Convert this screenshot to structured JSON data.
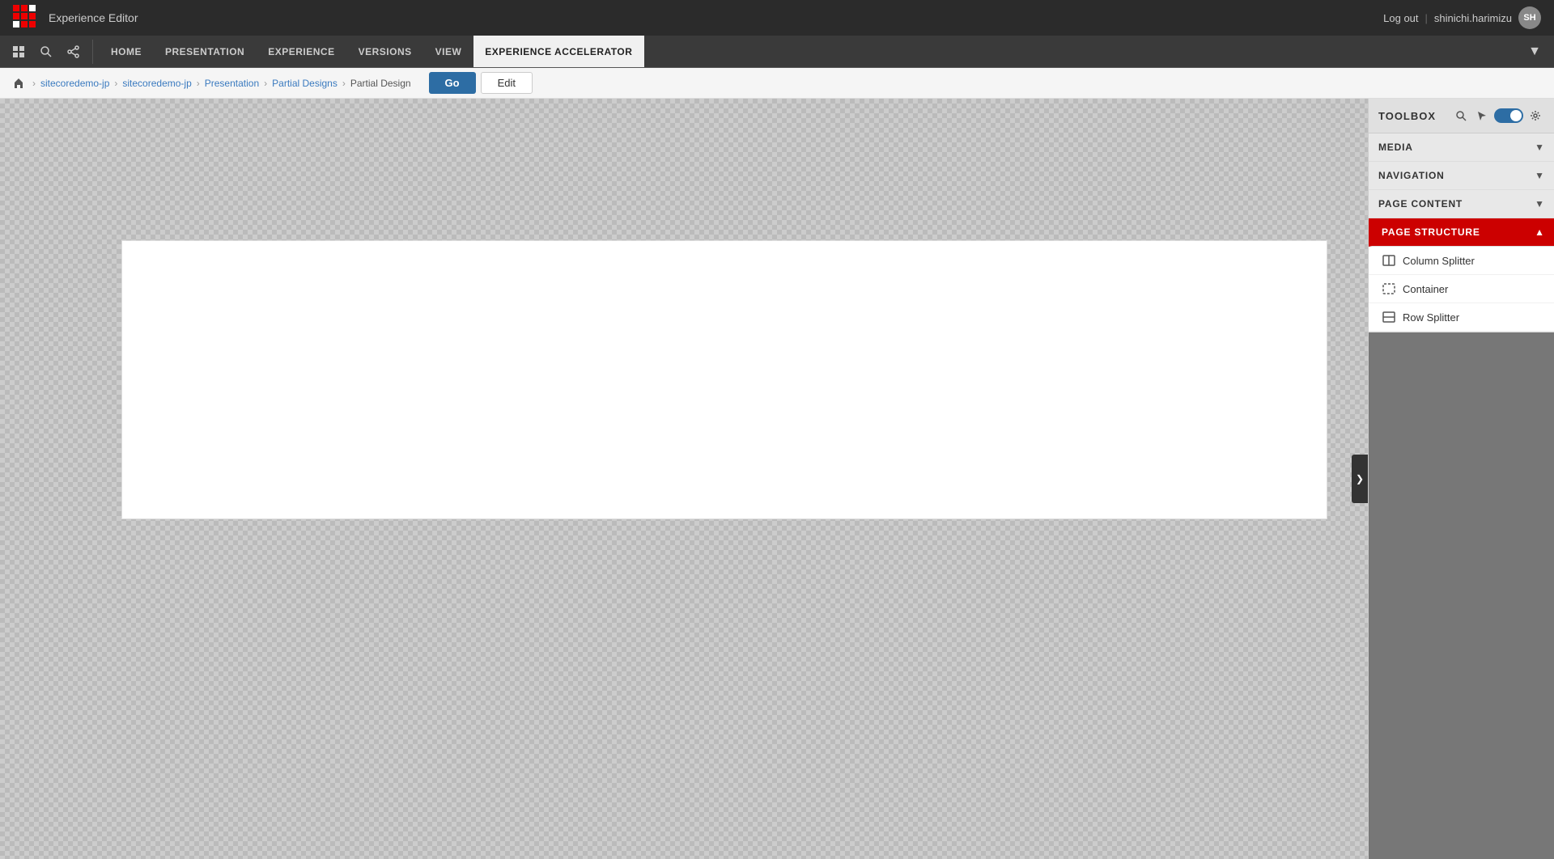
{
  "titleBar": {
    "appTitle": "Experience Editor",
    "logoutLabel": "Log out",
    "username": "shinichi.harimizu",
    "avatarInitials": "SH"
  },
  "navBar": {
    "tabs": [
      {
        "id": "home",
        "label": "HOME",
        "active": false
      },
      {
        "id": "presentation",
        "label": "PRESENTATION",
        "active": false
      },
      {
        "id": "experience",
        "label": "EXPERIENCE",
        "active": false
      },
      {
        "id": "versions",
        "label": "VERSIONS",
        "active": false
      },
      {
        "id": "view",
        "label": "VIEW",
        "active": false
      },
      {
        "id": "experience-accelerator",
        "label": "EXPERIENCE ACCELERATOR",
        "active": true
      }
    ]
  },
  "breadcrumb": {
    "items": [
      {
        "label": "sitecoredemo-jp",
        "link": true
      },
      {
        "label": "sitecoredemo-jp",
        "link": true
      },
      {
        "label": "Presentation",
        "link": true
      },
      {
        "label": "Partial Designs",
        "link": true
      },
      {
        "label": "Partial Design",
        "link": false
      }
    ],
    "goLabel": "Go",
    "editLabel": "Edit"
  },
  "toolbox": {
    "title": "TOOLBOX",
    "sections": [
      {
        "id": "media",
        "label": "MEDIA",
        "expanded": false
      },
      {
        "id": "navigation",
        "label": "NAVIGATION",
        "expanded": false
      },
      {
        "id": "page-content",
        "label": "PAGE CONTENT",
        "expanded": false
      },
      {
        "id": "page-structure",
        "label": "PAGE STRUCTURE",
        "expanded": true,
        "items": [
          {
            "id": "column-splitter",
            "label": "Column Splitter",
            "icon": "columns"
          },
          {
            "id": "container",
            "label": "Container",
            "icon": "container"
          },
          {
            "id": "row-splitter",
            "label": "Row Splitter",
            "icon": "rows"
          }
        ]
      }
    ]
  },
  "canvas": {
    "collapseArrow": "❯"
  }
}
